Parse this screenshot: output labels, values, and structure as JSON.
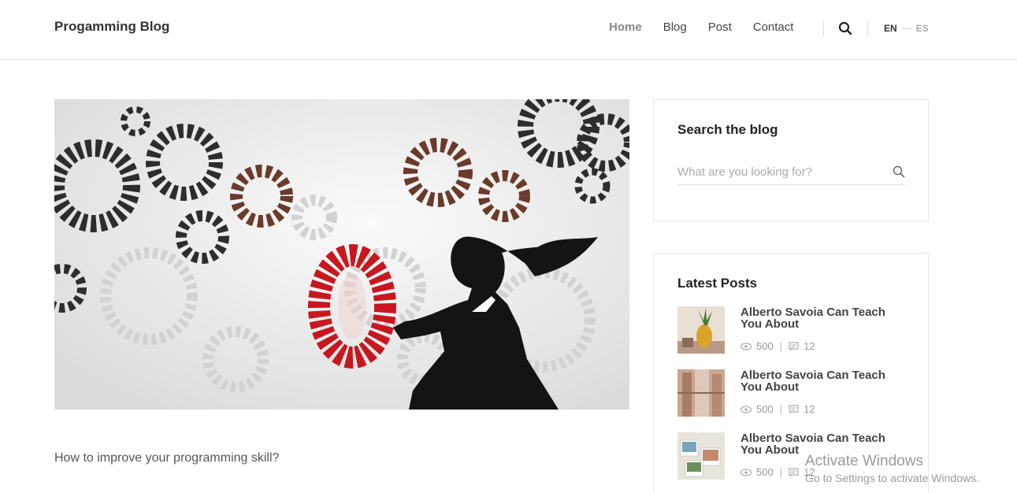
{
  "header": {
    "brand": "Progamming Blog",
    "nav": [
      {
        "label": "Home",
        "active": true
      },
      {
        "label": "Blog",
        "active": false
      },
      {
        "label": "Post",
        "active": false
      },
      {
        "label": "Contact",
        "active": false
      }
    ],
    "languages": {
      "current": "EN",
      "other": "ES"
    }
  },
  "main": {
    "hero_image_icon": "gears-illustration",
    "post_title": "How to improve your programming skill?"
  },
  "sidebar": {
    "search": {
      "title": "Search the blog",
      "placeholder": "What are you looking for?"
    },
    "latest": {
      "title": "Latest Posts",
      "items": [
        {
          "title": "Alberto Savoia Can Teach You About",
          "views": "500",
          "comments": "12",
          "thumb": "pineapple-photo"
        },
        {
          "title": "Alberto Savoia Can Teach You About",
          "views": "500",
          "comments": "12",
          "thumb": "wood-door-photo"
        },
        {
          "title": "Alberto Savoia Can Teach You About",
          "views": "500",
          "comments": "12",
          "thumb": "polaroids-photo"
        }
      ]
    }
  },
  "watermark": {
    "line1": "Activate Windows",
    "line2": "Go to Settings to activate Windows."
  },
  "colors": {
    "text": "#333333",
    "muted": "#999999",
    "border": "#e8e8e8",
    "accent_red": "#c8171f"
  }
}
